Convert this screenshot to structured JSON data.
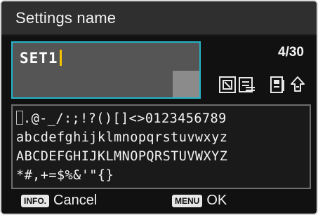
{
  "title": "Settings name",
  "input": {
    "value": "SET1",
    "counter": "4/30"
  },
  "character_grid": {
    "row1": ". @ - _ / : ; ! ? ( ) [ ] < > 0 1 2 3 4 5 6 7 8 9",
    "row1_display": ".@-_/:;!?()[]<>0123456789",
    "row2": "abcdefghijklmnopqrstuvwxyz",
    "row3": "ABCDEFGHIJKLMNOPQRSTUVWXYZ",
    "row4": "*#,+=$%&'\"{}"
  },
  "mode_icons": [
    "delete-char-icon",
    "insert-icon",
    "input-mode-icon",
    "case-toggle-icon"
  ],
  "footer": {
    "info_key": "INFO.",
    "cancel_label": "Cancel",
    "menu_key": "MENU",
    "ok_label": "OK"
  },
  "colors": {
    "accent": "#23b4c8",
    "cursor": "#f5c400",
    "background": "#111111"
  }
}
